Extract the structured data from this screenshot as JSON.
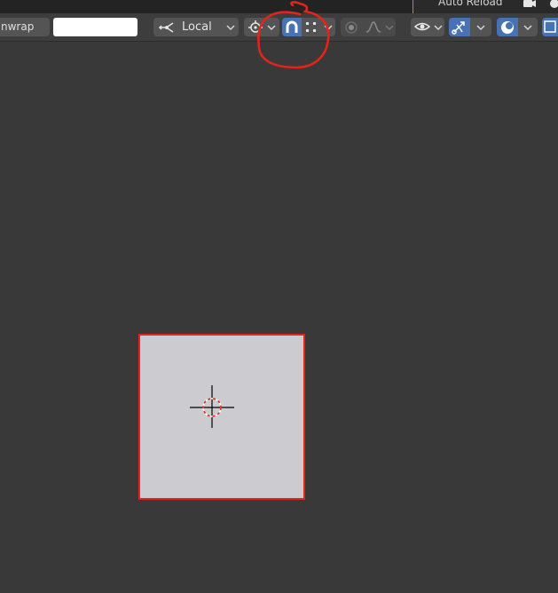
{
  "header": {
    "auto_reload_label": "Auto Reload"
  },
  "toolbar": {
    "operator_label": "nwrap",
    "text_field_value": "",
    "pivot": {
      "label": "Local",
      "icon": "pivot-icon"
    },
    "snap_toggle_active": true,
    "snap_element_icon": "grid-vertex-icon",
    "proportional_edit_active": false,
    "overlay_toggle_active": true,
    "gizmo_toggle_active": true
  },
  "colors": {
    "background": "#393939",
    "toolbar": "#3d3d3d",
    "button": "#545454",
    "active_blue": "#4772b3",
    "uv_face": "#cbcbd0",
    "uv_edge_selected": "#e3241a",
    "annotation_red": "#e3241a",
    "header_accent": "#e07b1a"
  }
}
